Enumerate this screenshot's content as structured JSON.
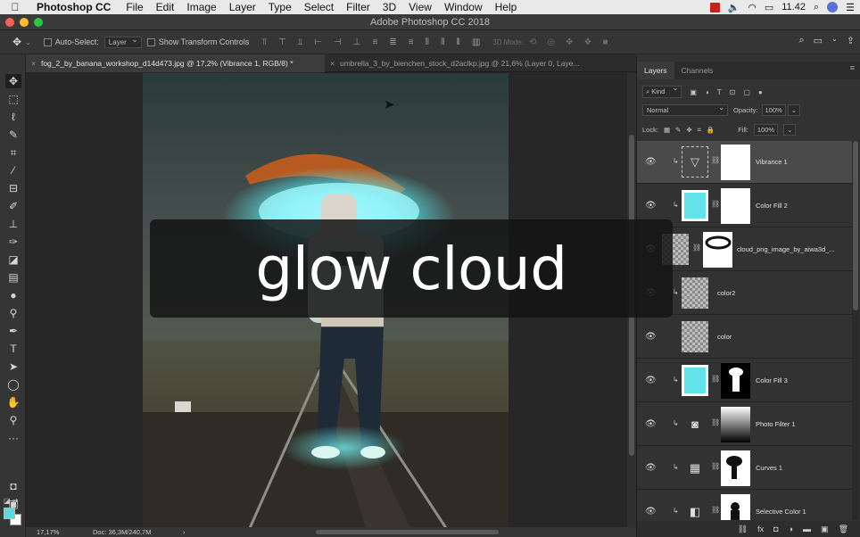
{
  "menubar": {
    "apple": "",
    "app_name": "Photoshop CC",
    "items": [
      "File",
      "Edit",
      "Image",
      "Layer",
      "Type",
      "Select",
      "Filter",
      "3D",
      "View",
      "Window",
      "Help"
    ],
    "time": "11.42",
    "wifi_icon": "wifi-icon",
    "volume_icon": "volume-icon",
    "battery_icon": "battery-icon"
  },
  "window": {
    "title": "Adobe Photoshop CC 2018"
  },
  "options": {
    "auto_select_label": "Auto-Select:",
    "auto_select_value": "Layer",
    "show_transform_label": "Show Transform Controls",
    "mode_3d_label": "3D Mode:"
  },
  "tabs": [
    {
      "label": "fog_2_by_banana_workshop_d14d473.jpg @ 17,2% (Vibrance 1, RGB/8) *",
      "close": "×"
    },
    {
      "label": "umbrella_3_by_bienchen_stock_d2aclkp.jpg @ 21,6% (Layer 0, Laye...",
      "close": "×"
    }
  ],
  "status": {
    "zoom": "17,17%",
    "doc": "Doc: 36,3M/240,7M",
    "arrow": "›"
  },
  "panel": {
    "tabs": [
      "Layers",
      "Channels"
    ],
    "filter_kind": "Kind",
    "blend_mode": "Normal",
    "opacity_label": "Opacity:",
    "opacity_value": "100%",
    "lock_label": "Lock:",
    "fill_label": "Fill:",
    "fill_value": "100%"
  },
  "layers": [
    {
      "name": "Vibrance 1",
      "thumb": "adjustment"
    },
    {
      "name": "Color Fill 2",
      "thumb": "cyan"
    },
    {
      "name": "cloud_png_image_by_aiwa3d_...",
      "thumb": "checker"
    },
    {
      "name": "color2",
      "thumb": "checker"
    },
    {
      "name": "color",
      "thumb": "checker"
    },
    {
      "name": "Color Fill 3",
      "thumb": "cyan"
    },
    {
      "name": "Photo Filter 1",
      "thumb": "adjustment"
    },
    {
      "name": "Curves 1",
      "thumb": "adjustment"
    },
    {
      "name": "Selective Color 1",
      "thumb": "adjustment"
    }
  ],
  "caption": "glow cloud",
  "colors": {
    "foreground": "#57d9dd",
    "background": "#ffffff",
    "cyan_fill": "#62e3ea"
  }
}
